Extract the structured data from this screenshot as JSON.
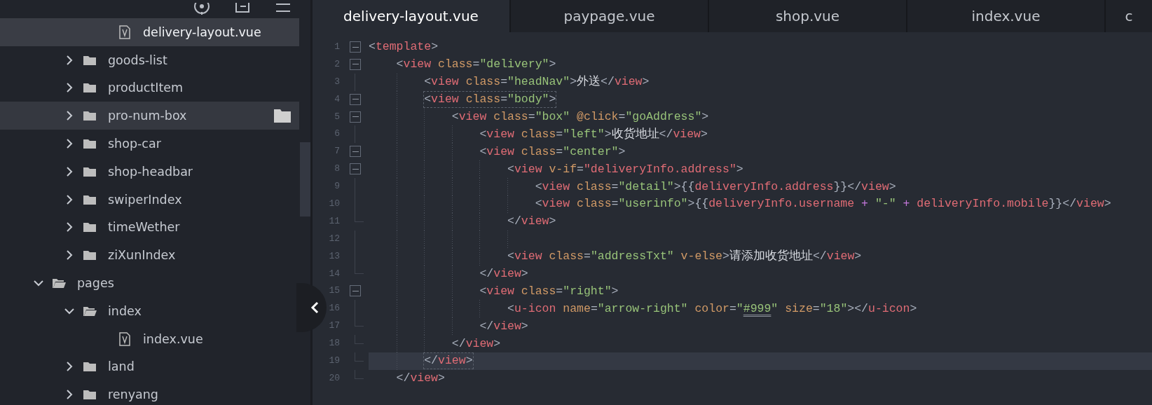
{
  "sidebar": {
    "toolbar": [
      {
        "kind": "target"
      },
      {
        "kind": "document"
      },
      {
        "kind": "menu"
      }
    ],
    "tree": [
      {
        "children": [
          {
            "children": [
              {
                "kind": "file",
                "label": "delivery-layout.vue",
                "selected": true,
                "hovered": false
              }
            ]
          },
          {
            "kind": "folder",
            "label": "goods-list",
            "expanded": false,
            "selected": false,
            "hovered": false
          },
          {
            "kind": "folder",
            "label": "productItem",
            "expanded": false,
            "selected": false,
            "hovered": false
          },
          {
            "kind": "folder",
            "label": "pro-num-box",
            "expanded": false,
            "selected": false,
            "hovered": true
          },
          {
            "kind": "folder",
            "label": "shop-car",
            "expanded": false,
            "selected": false,
            "hovered": false
          },
          {
            "kind": "folder",
            "label": "shop-headbar",
            "expanded": false,
            "selected": false,
            "hovered": false
          },
          {
            "kind": "folder",
            "label": "swiperIndex",
            "expanded": false,
            "selected": false,
            "hovered": false
          },
          {
            "kind": "folder",
            "label": "timeWether",
            "expanded": false,
            "selected": false,
            "hovered": false
          },
          {
            "kind": "folder",
            "label": "ziXunIndex",
            "expanded": false,
            "selected": false,
            "hovered": false
          }
        ]
      },
      {
        "kind": "folder",
        "label": "pages",
        "expanded": true,
        "selected": false,
        "hovered": false,
        "children": [
          {
            "kind": "folder",
            "label": "index",
            "expanded": true,
            "selected": false,
            "hovered": false,
            "children": [
              {
                "kind": "file",
                "label": "index.vue",
                "selected": false,
                "hovered": false
              }
            ]
          },
          {
            "kind": "folder",
            "label": "land",
            "expanded": false,
            "selected": false,
            "hovered": false
          },
          {
            "kind": "folder",
            "label": "renyang",
            "expanded": false,
            "selected": false,
            "hovered": false
          }
        ]
      }
    ]
  },
  "tabs": [
    {
      "label": "delivery-layout.vue",
      "selected": true
    },
    {
      "label": "paypage.vue",
      "selected": false
    },
    {
      "label": "shop.vue",
      "selected": false
    },
    {
      "label": "index.vue",
      "selected": false
    },
    {
      "label": "c",
      "selected": false
    }
  ],
  "editor": {
    "lines": [
      {
        "number": "1",
        "kind": "fold_start",
        "current": false,
        "matched": false,
        "text": "<template>"
      },
      {
        "number": "2",
        "kind": "fold_start",
        "current": false,
        "matched": false,
        "text": "    <view class=\"delivery\">"
      },
      {
        "number": "3",
        "kind": "fold_inner",
        "current": false,
        "matched": false,
        "text": "        <view class=\"headNav\">外送</view>"
      },
      {
        "number": "4",
        "kind": "fold_start",
        "current": false,
        "matched": true,
        "text": "        <view class=\"body\">"
      },
      {
        "number": "5",
        "kind": "fold_start",
        "current": false,
        "matched": false,
        "text": "            <view class=\"box\" @click=\"goAddress\">"
      },
      {
        "number": "6",
        "kind": "fold_inner",
        "current": false,
        "matched": false,
        "text": "                <view class=\"left\">收货地址</view>"
      },
      {
        "number": "7",
        "kind": "fold_start",
        "current": false,
        "matched": false,
        "text": "                <view class=\"center\">"
      },
      {
        "number": "8",
        "kind": "fold_start",
        "current": false,
        "matched": false,
        "text": "                    <view v-if=\"deliveryInfo.address\">"
      },
      {
        "number": "9",
        "kind": "fold_inner",
        "current": false,
        "matched": false,
        "text": "                        <view class=\"detail\">{{deliveryInfo.address}}</view>"
      },
      {
        "number": "10",
        "kind": "fold_inner",
        "current": false,
        "matched": false,
        "text": "                        <view class=\"userinfo\">{{deliveryInfo.username + \"-\" + deliveryInfo.mobile}}</view>"
      },
      {
        "number": "11",
        "kind": "fold_end",
        "current": false,
        "matched": false,
        "text": "                    </view>"
      },
      {
        "number": "12",
        "kind": "fold_inner",
        "current": false
      },
      {
        "number": "13",
        "kind": "fold_inner",
        "current": false,
        "matched": false,
        "text": "                    <view class=\"addressTxt\" v-else>请添加收货地址</view>"
      },
      {
        "number": "14",
        "kind": "fold_end",
        "current": false,
        "matched": false,
        "text": "                </view>"
      },
      {
        "number": "15",
        "kind": "fold_start",
        "current": false,
        "matched": false,
        "text": "                <view class=\"right\">"
      },
      {
        "number": "16",
        "kind": "fold_inner",
        "current": false,
        "matched": false,
        "text": "                    <u-icon name=\"arrow-right\" color=\"#999\" size=\"18\"></u-icon>"
      },
      {
        "number": "17",
        "kind": "fold_end",
        "current": false,
        "matched": false,
        "text": "                </view>"
      },
      {
        "number": "18",
        "kind": "fold_end",
        "current": false,
        "matched": false,
        "text": "            </view>"
      },
      {
        "number": "19",
        "kind": "fold_end",
        "current": true,
        "matched": true,
        "text": "        </view>"
      },
      {
        "number": "20",
        "kind": "fold_end",
        "current": false,
        "matched": false,
        "text": "    </view>"
      }
    ]
  }
}
